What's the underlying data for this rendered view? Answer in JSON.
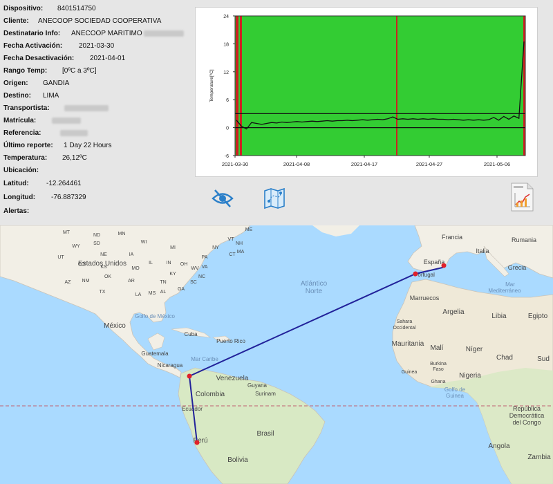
{
  "info": {
    "dispositivo": {
      "label": "Dispositivo:",
      "value": "8401514750"
    },
    "cliente": {
      "label": "Cliente:",
      "value": "ANECOOP SOCIEDAD COOPERATIVA"
    },
    "destinatario": {
      "label": "Destinatario Info:",
      "value": "ANECOOP MARITIMO"
    },
    "fecha_activacion": {
      "label": "Fecha Activación:",
      "value": "2021-03-30"
    },
    "fecha_desactivacion": {
      "label": "Fecha Desactivación:",
      "value": "2021-04-01"
    },
    "rango_temp": {
      "label": "Rango Temp:",
      "value": "[0ºC a 3ºC]"
    },
    "origen": {
      "label": "Origen:",
      "value": "GANDIA"
    },
    "destino": {
      "label": "Destino:",
      "value": "LIMA"
    },
    "transportista": {
      "label": "Transportista:",
      "value": ""
    },
    "matricula": {
      "label": "Matrícula:",
      "value": ""
    },
    "referencia": {
      "label": "Referencia:",
      "value": ""
    },
    "ultimo_reporte": {
      "label": "Último reporte:",
      "value": "1 Day 22 Hours"
    },
    "temperatura": {
      "label": "Temperatura:",
      "value": "26,12ºC"
    },
    "ubicacion": {
      "label": "Ubicación:",
      "value": ""
    },
    "latitud": {
      "label": "Latitud:",
      "value": "-12.264461"
    },
    "longitud": {
      "label": "Longitud:",
      "value": "-76.887329"
    },
    "alertas": {
      "label": "Alertas:",
      "value": ""
    }
  },
  "toolbar": {
    "hide_icon": "eye-slash-icon",
    "route_icon": "map-route-icon",
    "report_icon": "pdf-report-icon"
  },
  "chart_data": {
    "type": "line",
    "ylabel": "Temperature[ºC]",
    "xlabel": "",
    "ylim": [
      -6,
      24
    ],
    "yticks": [
      "24",
      "18",
      "12",
      "6",
      "0",
      "-6"
    ],
    "xticks": [
      "2021-03-30",
      "2021-04-08",
      "2021-04-17",
      "2021-04-27",
      "2021-05-06"
    ],
    "threshold_lines": [
      0,
      3
    ],
    "background_color": "#33cc33",
    "alert_color": "#cc2222",
    "series": [
      {
        "values": [
          1.6,
          0.3,
          -0.3,
          1.1,
          0.9,
          0.7,
          0.9,
          1.1,
          1.0,
          1.2,
          1.1,
          1.2,
          1.3,
          1.2,
          1.3,
          1.4,
          1.3,
          1.4,
          1.5,
          1.4,
          1.5,
          1.5,
          1.6,
          1.5,
          1.6,
          1.7,
          1.6,
          1.7,
          1.8,
          1.7,
          1.9,
          2.3,
          1.8,
          1.9,
          1.8,
          1.9,
          1.8,
          1.9,
          1.8,
          1.9,
          1.8,
          1.8,
          1.7,
          1.8,
          1.7,
          1.6,
          1.7,
          1.6,
          1.7,
          1.6,
          1.7,
          2.2,
          1.6,
          2.4,
          1.8,
          2.5,
          2.0,
          18.5
        ]
      }
    ],
    "line_color": "#111111"
  },
  "map": {
    "labels": {
      "estados_unidos": "Estados Unidos",
      "mexico": "México",
      "golfo_mexico": "Golfo de México",
      "cuba": "Cuba",
      "puerto_rico": "Puerto Rico",
      "mar_caribe": "Mar Caribe",
      "guatemala": "Guatemala",
      "nicaragua": "Nicaragua",
      "venezuela": "Venezuela",
      "guyana": "Guyana",
      "surinam": "Surinam",
      "colombia": "Colombia",
      "ecuador": "Ecuador",
      "peru": "Perú",
      "brasil": "Brasil",
      "bolivia": "Bolivia",
      "atlantico1": "Atlántico",
      "atlantico2": "Norte",
      "portugal": "Portugal",
      "espana": "España",
      "francia": "Francia",
      "italia": "Italia",
      "rumania": "Rumania",
      "grecia": "Grecia",
      "marruecos": "Marruecos",
      "argelia": "Argelia",
      "libia": "Libia",
      "egipto": "Egipto",
      "mar_med1": "Mar",
      "mar_med2": "Mediterráneo",
      "sahara1": "Sahara",
      "sahara2": "Occidental",
      "mauritania": "Mauritania",
      "mali": "Malí",
      "niger": "Níger",
      "chad": "Chad",
      "sudan": "Sud",
      "burkina1": "Burkina",
      "burkina2": "Faso",
      "guinea": "Guinea",
      "ghana": "Ghana",
      "nigeria": "Nigeria",
      "golfo_guinea1": "Golfo de",
      "golfo_guinea2": "Guinea",
      "rep_dem1": "República",
      "rep_dem2": "Democrática",
      "rep_dem3": "del Congo",
      "angola": "Angola",
      "zambia": "Zambia",
      "us_states": [
        "ND",
        "MT",
        "SD",
        "WY",
        "NE",
        "UT",
        "CO",
        "KS",
        "MO",
        "OK",
        "TX",
        "AZ",
        "NM",
        "AR",
        "LA",
        "MS",
        "AL",
        "GA",
        "SC",
        "TN",
        "KY",
        "IN",
        "OH",
        "IL",
        "IA",
        "MN",
        "WI",
        "MI",
        "PA",
        "NY",
        "VA",
        "NC",
        "ME",
        "VT",
        "NH",
        "MA",
        "CT",
        "WV"
      ]
    },
    "route_color": "#22229a",
    "marker_color": "#e0202a"
  }
}
